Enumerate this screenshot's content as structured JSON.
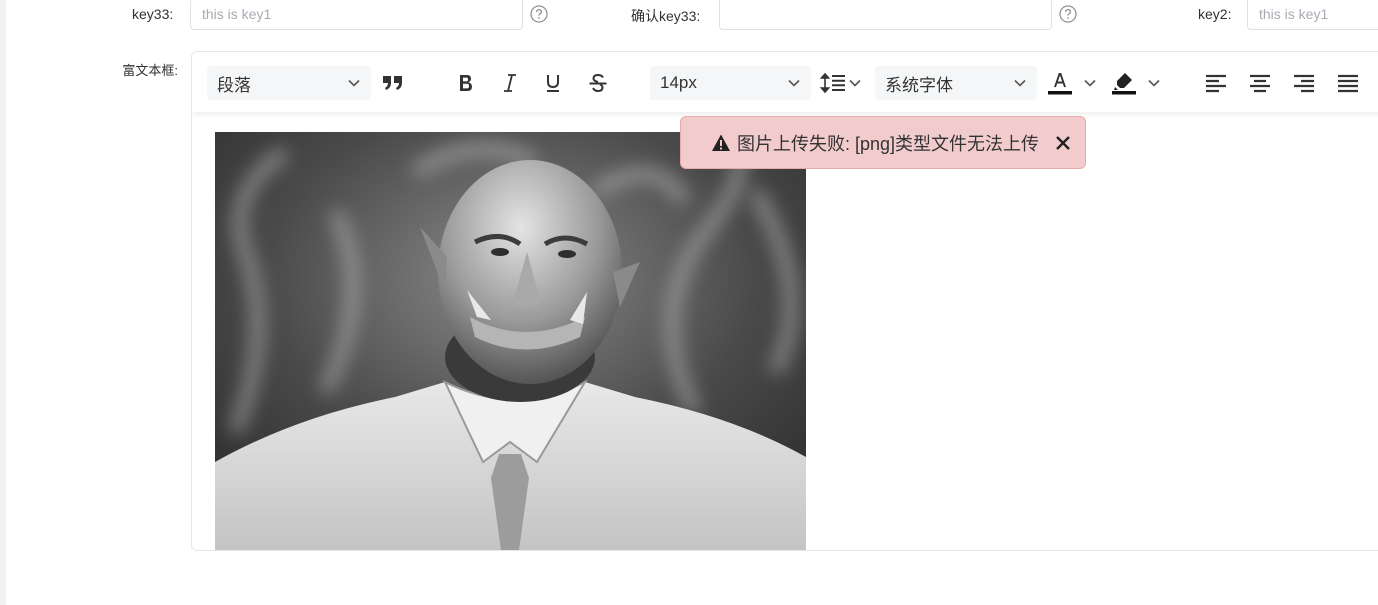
{
  "form": {
    "key33_label": "key33:",
    "key33_placeholder": "this is key1",
    "confirm_key33_label": "确认key33:",
    "confirm_key33_value": "",
    "key2_label": "key2:",
    "key2_placeholder": "this is key1",
    "rich_text_label": "富文本框:"
  },
  "toolbar": {
    "paragraph_select": "段落",
    "font_size_select": "14px",
    "font_family_select": "系统字体",
    "icons": [
      "quote-icon",
      "bold-icon",
      "italic-icon",
      "underline-icon",
      "strikethrough-icon",
      "line-height-icon",
      "font-color-icon",
      "highlight-icon",
      "align-left-icon",
      "align-center-icon",
      "align-right-icon",
      "justify-icon"
    ]
  },
  "alert": {
    "message": "图片上传失败: [png]类型文件无法上传",
    "icon": "warning-icon",
    "background": "#f2cccc"
  },
  "editor_content": {
    "image": "grayscale portrait of an orc with tusks wearing a shirt and tie in smoke"
  }
}
